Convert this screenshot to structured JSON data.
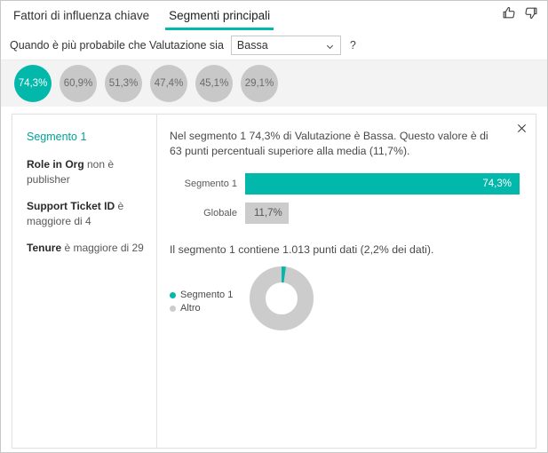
{
  "header": {
    "tabs": [
      {
        "label": "Fattori di influenza chiave",
        "active": false
      },
      {
        "label": "Segmenti principali",
        "active": true
      }
    ],
    "feedback": {
      "thumbs_up": "thumbs-up-icon",
      "thumbs_down": "thumbs-down-icon"
    }
  },
  "question": {
    "prompt": "Quando è più probabile che Valutazione sia",
    "selected_value": "Bassa",
    "help": "?"
  },
  "segments": {
    "bubbles": [
      {
        "label": "74,3%",
        "selected": true
      },
      {
        "label": "60,9%",
        "selected": false
      },
      {
        "label": "51,3%",
        "selected": false
      },
      {
        "label": "47,4%",
        "selected": false
      },
      {
        "label": "45,1%",
        "selected": false
      },
      {
        "label": "29,1%",
        "selected": false
      }
    ]
  },
  "detail": {
    "close": "×",
    "segment_title": "Segmento 1",
    "rules": [
      {
        "field": "Role in Org",
        "text": " non è publisher"
      },
      {
        "field": "Support Ticket ID",
        "text": " è maggiore di 4"
      },
      {
        "field": "Tenure",
        "text": " è maggiore di 29"
      }
    ],
    "summary": "Nel segmento 1 74,3% di Valutazione è Bassa. Questo valore è di 63 punti percentuali superiore alla media (11,7%).",
    "datapoints_note": "Il segmento 1 contiene 1.013 punti dati (2,2% dei dati)."
  },
  "colors": {
    "accent_teal": "#01b8aa",
    "teal_text": "#01a299",
    "gray_bubble": "#c8c8c8",
    "gray_bar": "#cccccc",
    "strip_bg": "#f3f3f3"
  },
  "chart_data": [
    {
      "type": "bar",
      "title": "",
      "orientation": "horizontal",
      "categories": [
        "Segmento 1",
        "Globale"
      ],
      "values": [
        74.3,
        11.7
      ],
      "value_labels": [
        "74,3%",
        "11,7%"
      ],
      "series": [
        {
          "name": "Segmento 1",
          "values": [
            74.3
          ],
          "color": "#01b8aa"
        },
        {
          "name": "Globale",
          "values": [
            11.7
          ],
          "color": "#cccccc"
        }
      ],
      "xlabel": "",
      "ylabel": "",
      "xlim": [
        0,
        74.3
      ],
      "grid": false,
      "legend": "none"
    },
    {
      "type": "pie",
      "subtype": "donut",
      "title": "",
      "categories": [
        "Segmento 1",
        "Altro"
      ],
      "values": [
        2.2,
        97.8
      ],
      "colors": [
        "#01b8aa",
        "#cccccc"
      ],
      "legend": [
        "Segmento 1",
        "Altro"
      ],
      "legend_position": "left",
      "annotation": "Il segmento 1 contiene 1.013 punti dati (2,2% dei dati)."
    }
  ]
}
